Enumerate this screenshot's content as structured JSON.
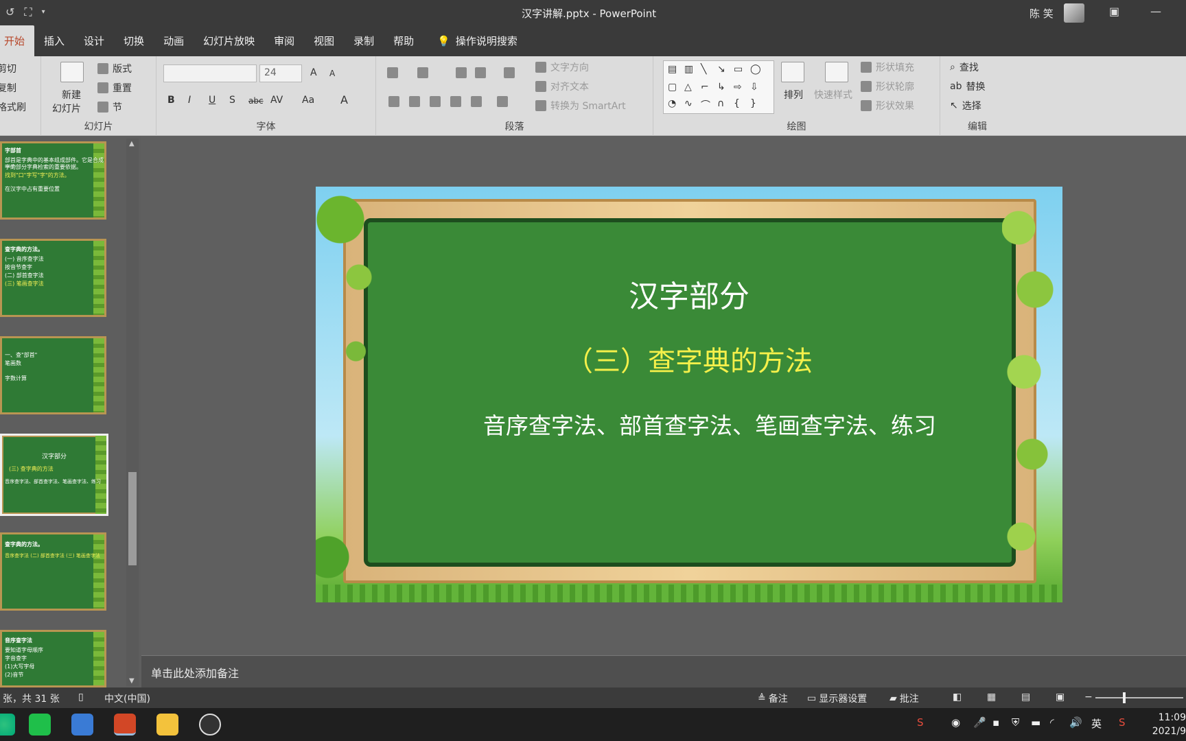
{
  "titlebar": {
    "title": "汉字讲解.pptx  -  PowerPoint",
    "user": "陈 笑"
  },
  "tabs": [
    "开始",
    "插入",
    "设计",
    "切换",
    "动画",
    "幻灯片放映",
    "审阅",
    "视图",
    "录制",
    "帮助"
  ],
  "tell_me": "操作说明搜索",
  "ribbon": {
    "clipboard": {
      "cut": "剪切",
      "copy": "复制",
      "format_painter": "格式刷"
    },
    "slides": {
      "new_slide_1": "新建",
      "new_slide_2": "幻灯片",
      "layout": "版式",
      "reset": "重置",
      "section": "节",
      "label": "幻灯片"
    },
    "font": {
      "font_size": "24",
      "bold": "B",
      "italic": "I",
      "underline": "U",
      "shadow": "S",
      "strike": "abc",
      "spacing": "AV",
      "case": "Aa",
      "color": "A",
      "grow": "A",
      "shrink": "A",
      "label": "字体"
    },
    "paragraph": {
      "text_direction": "文字方向",
      "align_text": "对齐文本",
      "smartart": "转换为 SmartArt",
      "label": "段落"
    },
    "drawing": {
      "arrange": "排列",
      "quick_styles": "快速样式",
      "shape_fill": "形状填充",
      "shape_outline": "形状轮廓",
      "shape_effects": "形状效果",
      "label": "绘图"
    },
    "editing": {
      "find": "查找",
      "replace": "替换",
      "select": "选择",
      "label": "编辑"
    }
  },
  "thumbnails": [
    {
      "title": "字部首",
      "lines": [
        "部首是字典中的基本组成部件。它是合成字的",
        "一个部分字典检索的重要依据。",
        "找到\"口\"字写\"字\"的方法。",
        "",
        "在汉字中占有重要位置"
      ],
      "selected": false
    },
    {
      "title": "查字典的方法。",
      "lines": [
        "(一) 音序查字法",
        "按音节查字",
        "(二) 部首查字法",
        "(三) 笔画查字法"
      ],
      "selected": false
    },
    {
      "title": "",
      "lines": [
        "一、查\"部首\"",
        "笔画数",
        "",
        "字数计算"
      ],
      "selected": false
    },
    {
      "title": "汉字部分",
      "subtitle": "(三) 查字典的方法",
      "lines": [
        "音序查字法、部首查字法、笔画查字法、练习"
      ],
      "selected": true
    },
    {
      "title": "查字典的方法。",
      "subtitle": "音序查字法 (二) 部首查字法 (三) 笔画查字法",
      "lines": [],
      "selected": false
    },
    {
      "title": "音序查字法",
      "lines": [
        "要知道字母顺序",
        "字音查字",
        "(1)大写字母",
        "(2)音节"
      ],
      "selected": false
    }
  ],
  "slide": {
    "title": "汉字部分",
    "subtitle": "（三）查字典的方法",
    "body": "音序查字法、部首查字法、笔画查字法、练习"
  },
  "notes_placeholder": "单击此处添加备注",
  "status": {
    "slide_count": "张，共 31 张",
    "language": "中文(中国)",
    "notes": "备注",
    "display_settings": "显示器设置",
    "comments": "批注"
  },
  "tray": {
    "ime": "英",
    "time": "11:09",
    "date": "2021/9"
  },
  "colors": {
    "board_green": "#3a8a37",
    "subtitle_yellow": "#f5f04a",
    "accent_orange": "#b7472a"
  }
}
